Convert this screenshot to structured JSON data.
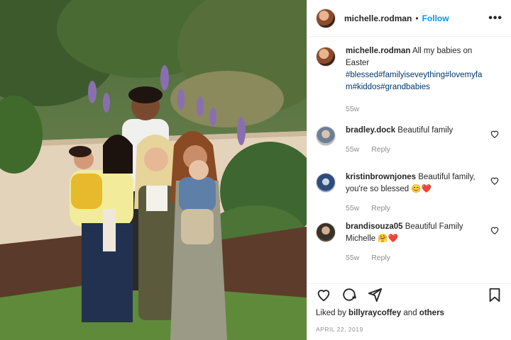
{
  "post": {
    "username": "michelle.rodman",
    "separator": "•",
    "follow_label": "Follow",
    "more_label": "•••",
    "caption_user": "michelle.rodman",
    "caption_text": "All my babies on Easter",
    "caption_tags": "#blessed#familyiseveything#lovemyfam#kiddos#grandbabies",
    "caption_age": "55w"
  },
  "comments": [
    {
      "user": "bradley.dock",
      "text": "Beautiful family",
      "age": "55w",
      "reply": "Reply",
      "icon": "avatar-photo"
    },
    {
      "user": "kristinbrownjones",
      "text": "Beautiful family, you're so blessed 😊❤️",
      "age": "55w",
      "reply": "Reply",
      "icon": "avatar-photo"
    },
    {
      "user": "brandisouza05",
      "text": "Beautiful Family Michelle 🤗❤️",
      "age": "55w",
      "reply": "Reply",
      "icon": "avatar-photo"
    }
  ],
  "footer": {
    "liked_prefix": "Liked by",
    "liked_user": "billyraycoffey",
    "liked_and": "and",
    "liked_others": "others",
    "date": "APRIL 22, 2019"
  },
  "icons": [
    "heart-icon",
    "comment-icon",
    "share-icon",
    "bookmark-icon",
    "more-icon"
  ],
  "colors": {
    "follow": "#0095f6",
    "muted": "#8e8e8e",
    "hashtag": "#00376b"
  }
}
